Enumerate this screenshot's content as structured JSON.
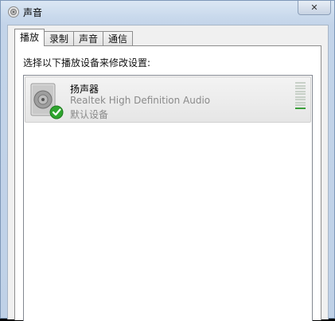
{
  "window": {
    "title": "声音",
    "close": "✕"
  },
  "tabs": [
    "播放",
    "录制",
    "声音",
    "通信"
  ],
  "active_tab": 0,
  "playback": {
    "instruction": "选择以下播放设备来修改设置:",
    "devices": [
      {
        "name": "扬声器",
        "driver": "Realtek High Definition Audio",
        "status": "默认设备",
        "level_fraction": 0.1,
        "default": true
      }
    ]
  },
  "colors": {
    "check_green": "#2fa52f",
    "meter_on": "#3a9e3a"
  }
}
